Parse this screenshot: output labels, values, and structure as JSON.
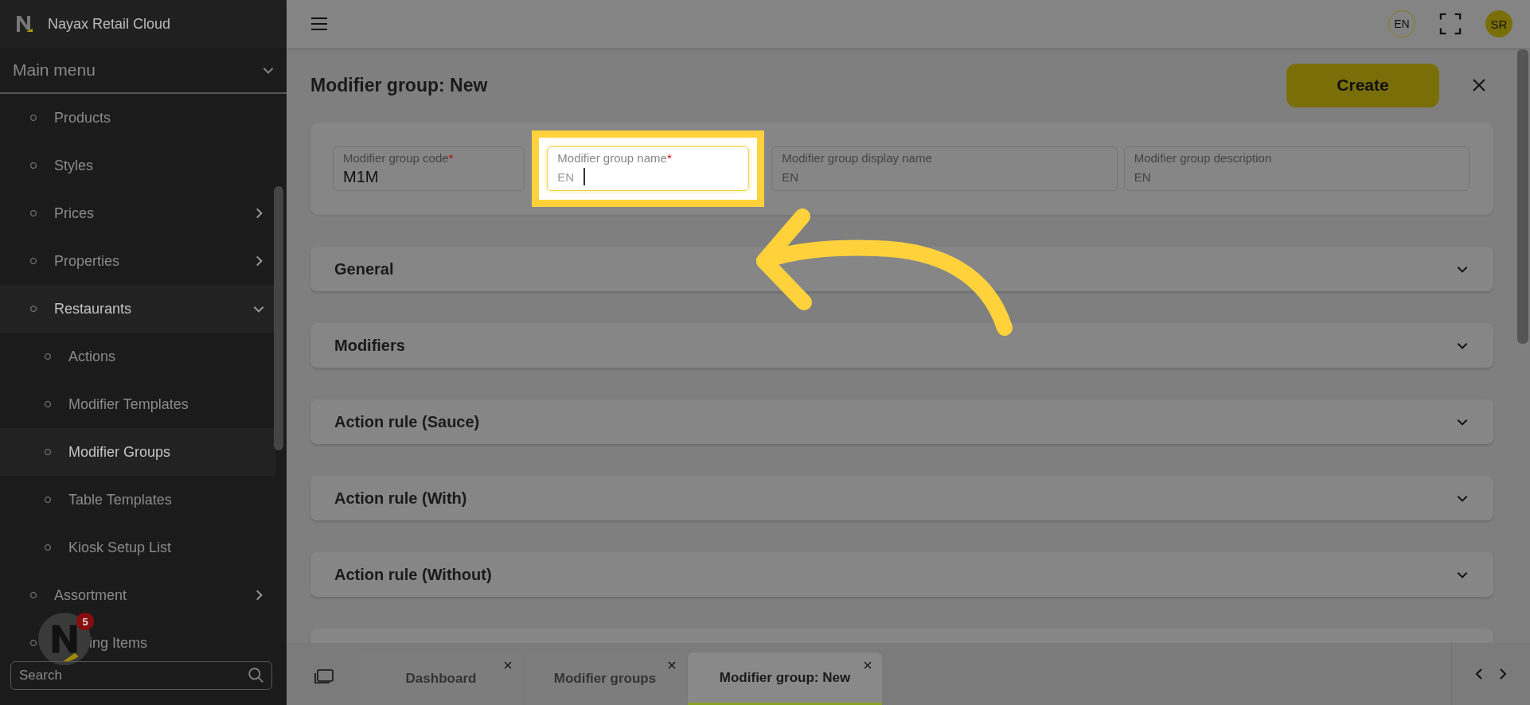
{
  "app": {
    "title": "Nayax Retail Cloud"
  },
  "sidebar": {
    "menu_title": "Main menu",
    "items": [
      {
        "label": "Products",
        "kind": "link",
        "selected": false
      },
      {
        "label": "Styles",
        "kind": "link",
        "selected": false
      },
      {
        "label": "Prices",
        "kind": "group",
        "selected": false,
        "expanded": false
      },
      {
        "label": "Properties",
        "kind": "group",
        "selected": false,
        "expanded": false
      },
      {
        "label": "Restaurants",
        "kind": "group",
        "selected": true,
        "expanded": true,
        "children": [
          {
            "label": "Actions",
            "selected": false
          },
          {
            "label": "Modifier Templates",
            "selected": false
          },
          {
            "label": "Modifier Groups",
            "selected": true
          },
          {
            "label": "Table Templates",
            "selected": false
          },
          {
            "label": "Kiosk Setup List",
            "selected": false
          }
        ]
      },
      {
        "label": "Assortment",
        "kind": "group",
        "selected": false,
        "expanded": false
      },
      {
        "label": "ing Items",
        "kind": "link",
        "selected": false
      }
    ],
    "search": {
      "placeholder": "Search"
    },
    "notification_count": "5"
  },
  "topbar": {
    "language": "EN",
    "avatar": "SR"
  },
  "page": {
    "title": "Modifier group: New",
    "create_button": "Create",
    "fields": [
      {
        "label": "Modifier group code",
        "required_mark": "*",
        "value": "M1M",
        "focused": false
      },
      {
        "label": "Modifier group name",
        "required_mark": "*",
        "prefix": "EN",
        "focused": true
      },
      {
        "label": "Modifier group display name",
        "prefix": "EN",
        "focused": false
      },
      {
        "label": "Modifier group description",
        "prefix": "EN",
        "focused": false
      }
    ],
    "sections": [
      {
        "title": "General"
      },
      {
        "title": "Modifiers"
      },
      {
        "title": "Action rule (Sauce)"
      },
      {
        "title": "Action rule (With)"
      },
      {
        "title": "Action rule (Without)"
      }
    ]
  },
  "tabs": [
    {
      "label": "Dashboard",
      "selected": false
    },
    {
      "label": "Modifier groups",
      "selected": false
    },
    {
      "label": "Modifier group: New",
      "selected": true
    }
  ]
}
